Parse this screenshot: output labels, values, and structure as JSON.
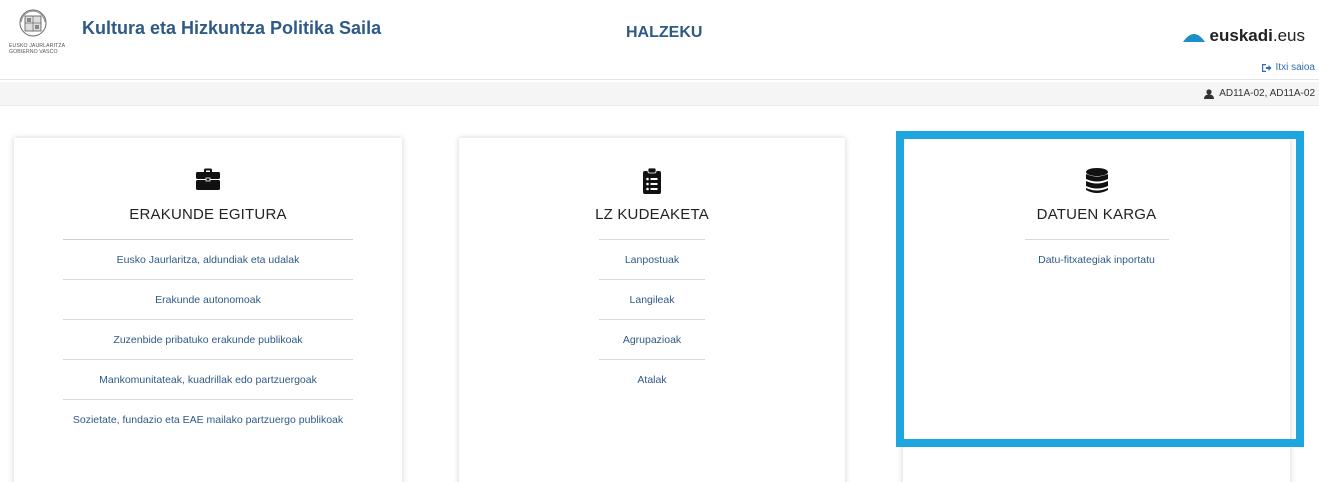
{
  "header": {
    "logo_line1": "EUSKO JAURLARITZA",
    "logo_line2": "GOBIERNO VASCO",
    "department": "Kultura eta Hizkuntza Politika Saila",
    "app_title": "HALZEKU",
    "brand_bold": "euskadi",
    "brand_suffix": ".eus",
    "logout_label": "Itxi saioa"
  },
  "user": {
    "roles": "AD11A-02, AD11A-02"
  },
  "cards": [
    {
      "title": "ERAKUNDE EGITURA",
      "icon": "briefcase-icon",
      "items": [
        "Eusko Jaurlaritza, aldundiak eta udalak",
        "Erakunde autonomoak",
        "Zuzenbide pribatuko erakunde publikoak",
        "Mankomunitateak, kuadrillak edo partzuergoak",
        "Sozietate, fundazio eta EAE mailako partzuergo publikoak"
      ]
    },
    {
      "title": "LZ KUDEAKETA",
      "icon": "clipboard-list-icon",
      "items": [
        "Lanpostuak",
        "Langileak",
        "Agrupazioak",
        "Atalak"
      ]
    },
    {
      "title": "DATUEN KARGA",
      "icon": "database-icon",
      "items": [
        "Datu-fitxategiak inportatu"
      ]
    }
  ],
  "colors": {
    "primary_text": "#2e5a87",
    "highlight": "#1ea7df"
  }
}
